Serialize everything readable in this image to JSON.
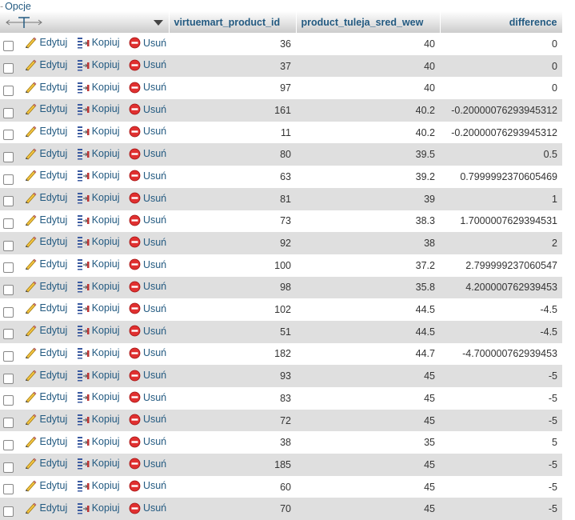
{
  "options_label": "Opcje",
  "columns": {
    "product_id": "virtuemart_product_id",
    "tuleja": "product_tuleja_sred_wew",
    "difference": "difference"
  },
  "actions": {
    "edit": "Edytuj",
    "copy": "Kopiuj",
    "delete": "Usuń"
  },
  "rows": [
    {
      "id": "36",
      "tuleja": "40",
      "diff": "0"
    },
    {
      "id": "37",
      "tuleja": "40",
      "diff": "0"
    },
    {
      "id": "97",
      "tuleja": "40",
      "diff": "0"
    },
    {
      "id": "161",
      "tuleja": "40.2",
      "diff": "-0.20000076293945312"
    },
    {
      "id": "11",
      "tuleja": "40.2",
      "diff": "-0.20000076293945312"
    },
    {
      "id": "80",
      "tuleja": "39.5",
      "diff": "0.5"
    },
    {
      "id": "63",
      "tuleja": "39.2",
      "diff": "0.7999992370605469"
    },
    {
      "id": "81",
      "tuleja": "39",
      "diff": "1"
    },
    {
      "id": "73",
      "tuleja": "38.3",
      "diff": "1.7000007629394531"
    },
    {
      "id": "92",
      "tuleja": "38",
      "diff": "2"
    },
    {
      "id": "100",
      "tuleja": "37.2",
      "diff": "2.799999237060547"
    },
    {
      "id": "98",
      "tuleja": "35.8",
      "diff": "4.200000762939453"
    },
    {
      "id": "102",
      "tuleja": "44.5",
      "diff": "-4.5"
    },
    {
      "id": "51",
      "tuleja": "44.5",
      "diff": "-4.5"
    },
    {
      "id": "182",
      "tuleja": "44.7",
      "diff": "-4.700000762939453"
    },
    {
      "id": "93",
      "tuleja": "45",
      "diff": "-5"
    },
    {
      "id": "83",
      "tuleja": "45",
      "diff": "-5"
    },
    {
      "id": "72",
      "tuleja": "45",
      "diff": "-5"
    },
    {
      "id": "38",
      "tuleja": "35",
      "diff": "5"
    },
    {
      "id": "185",
      "tuleja": "45",
      "diff": "-5"
    },
    {
      "id": "60",
      "tuleja": "45",
      "diff": "-5"
    },
    {
      "id": "70",
      "tuleja": "45",
      "diff": "-5"
    }
  ]
}
